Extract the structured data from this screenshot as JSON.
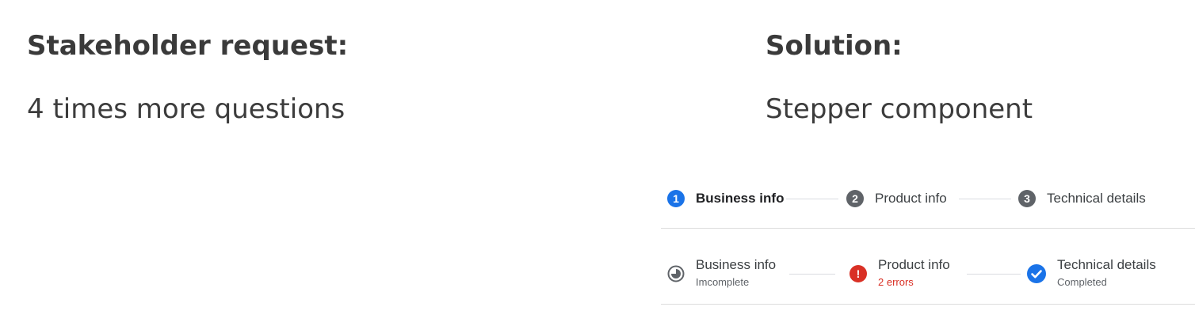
{
  "left": {
    "heading": "Stakeholder request:",
    "subtitle": "4 times more questions"
  },
  "right": {
    "heading": "Solution:",
    "subtitle": "Stepper component"
  },
  "stepper_top": {
    "steps": [
      {
        "number": "1",
        "label": "Business info",
        "state": "active",
        "icon": "number-circle-blue"
      },
      {
        "number": "2",
        "label": "Product info",
        "state": "inactive",
        "icon": "number-circle-gray"
      },
      {
        "number": "3",
        "label": "Technical details",
        "state": "inactive",
        "icon": "number-circle-gray"
      }
    ]
  },
  "stepper_bottom": {
    "steps": [
      {
        "label": "Business info",
        "status": "Imcomplete",
        "icon": "incomplete-progress-icon"
      },
      {
        "label": "Product info",
        "status": "2 errors",
        "icon": "error-icon",
        "color": "#d93025"
      },
      {
        "label": "Technical details",
        "status": "Completed",
        "icon": "check-circle-icon",
        "color": "#1a73e8"
      }
    ]
  },
  "colors": {
    "accent": "#1a73e8",
    "error": "#d93025",
    "neutral": "#5f6368"
  }
}
